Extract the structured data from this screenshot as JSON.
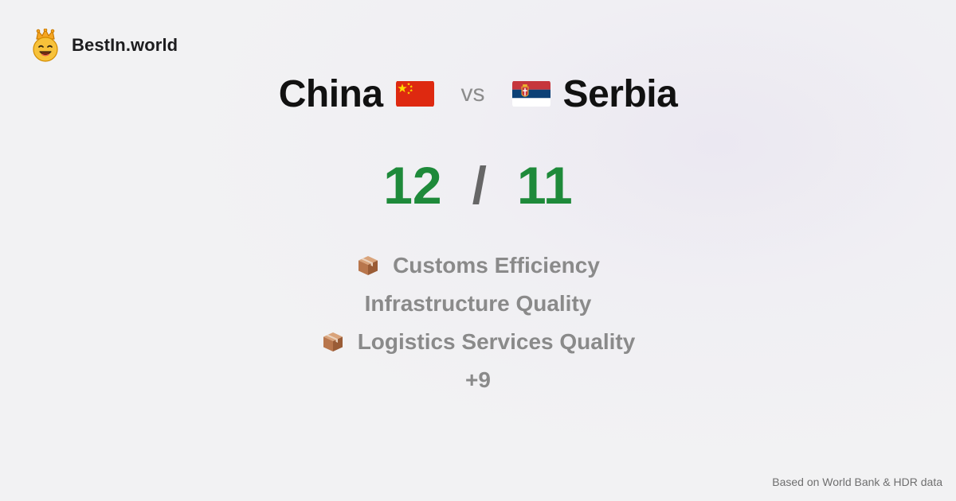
{
  "brand": {
    "name": "BestIn.world",
    "logo_icon": "smiling-crown-face-icon"
  },
  "comparison": {
    "country_a": {
      "name": "China",
      "flag_icon": "china-flag-icon"
    },
    "vs_label": "vs",
    "country_b": {
      "name": "Serbia",
      "flag_icon": "serbia-flag-icon"
    }
  },
  "score": {
    "a": "12",
    "separator": "/",
    "b": "11",
    "color": "#1e8a3a"
  },
  "metrics": [
    {
      "label": "Customs Efficiency",
      "icon": "package-box-icon"
    },
    {
      "label": "Infrastructure Quality",
      "icon": ""
    },
    {
      "label": "Logistics Services Quality",
      "icon": "package-box-icon"
    },
    {
      "label": "+9",
      "icon": ""
    }
  ],
  "footer": {
    "source": "Based on World Bank & HDR data"
  }
}
